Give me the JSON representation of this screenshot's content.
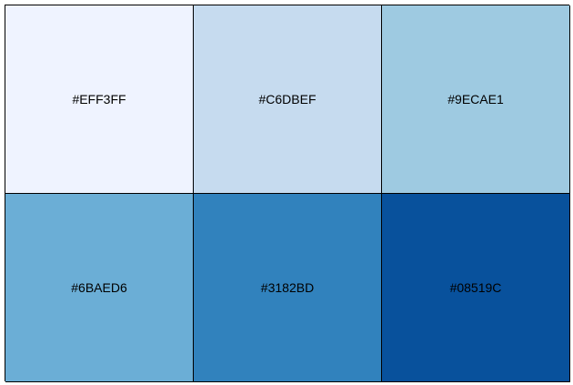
{
  "swatches": [
    {
      "label": "#EFF3FF",
      "color": "#EFF3FF"
    },
    {
      "label": "#C6DBEF",
      "color": "#C6DBEF"
    },
    {
      "label": "#9ECAE1",
      "color": "#9ECAE1"
    },
    {
      "label": "#6BAED6",
      "color": "#6BAED6"
    },
    {
      "label": "#3182BD",
      "color": "#3182BD"
    },
    {
      "label": "#08519C",
      "color": "#08519C"
    }
  ]
}
